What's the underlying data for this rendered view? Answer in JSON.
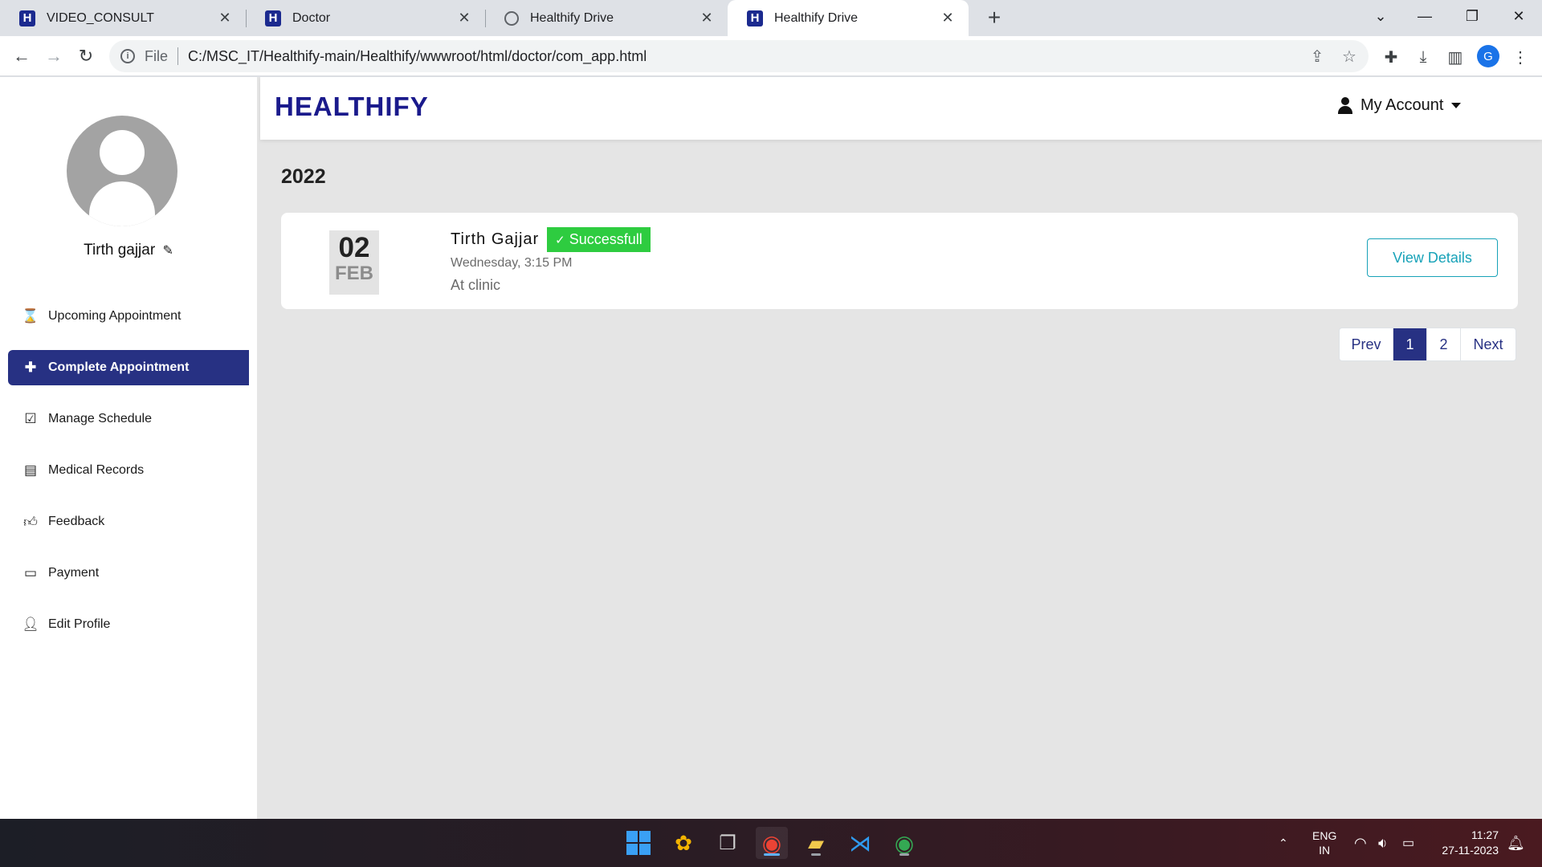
{
  "browser": {
    "tabs": [
      {
        "title": "VIDEO_CONSULT",
        "favicon": "H"
      },
      {
        "title": "Doctor",
        "favicon": "H"
      },
      {
        "title": "Healthify Drive",
        "favicon": "globe"
      },
      {
        "title": "Healthify Drive",
        "favicon": "H",
        "active": true
      }
    ],
    "address": {
      "scheme_label": "File",
      "url": "C:/MSC_IT/Healthify-main/Healthify/wwwroot/html/doctor/com_app.html"
    },
    "profile_initial": "G"
  },
  "sidebar": {
    "doctor_name": "Tirth gajjar",
    "items": [
      {
        "label": "Upcoming Appointment",
        "icon": "hourglass-icon"
      },
      {
        "label": "Complete Appointment",
        "icon": "hand-holding-medical-icon",
        "active": true
      },
      {
        "label": "Manage Schedule",
        "icon": "calendar-check-icon"
      },
      {
        "label": "Medical Records",
        "icon": "file-medical-icon"
      },
      {
        "label": "Feedback",
        "icon": "thumbs-up-icon"
      },
      {
        "label": "Payment",
        "icon": "credit-card-icon"
      },
      {
        "label": "Edit Profile",
        "icon": "user-edit-icon"
      }
    ]
  },
  "header": {
    "brand": "HEALTHIFY",
    "account_label": "My Account"
  },
  "main": {
    "year": "2022",
    "appointments": [
      {
        "day": "02",
        "month": "FEB",
        "patient_name": "Tirth Gajjar",
        "status": "Successfull",
        "time": "Wednesday, 3:15 PM",
        "location": "At clinic",
        "action_label": "View Details"
      }
    ],
    "pagination": {
      "prev_label": "Prev",
      "pages": [
        "1",
        "2"
      ],
      "current_page": "1",
      "next_label": "Next"
    }
  },
  "taskbar": {
    "lang_line1": "ENG",
    "lang_line2": "IN",
    "time": "11:27",
    "date": "27-11-2023"
  },
  "colors": {
    "brand": "#1a1a8c",
    "sidebar_active": "#273183",
    "status_success": "#2ecc40",
    "button_outline": "#17a2b8"
  }
}
